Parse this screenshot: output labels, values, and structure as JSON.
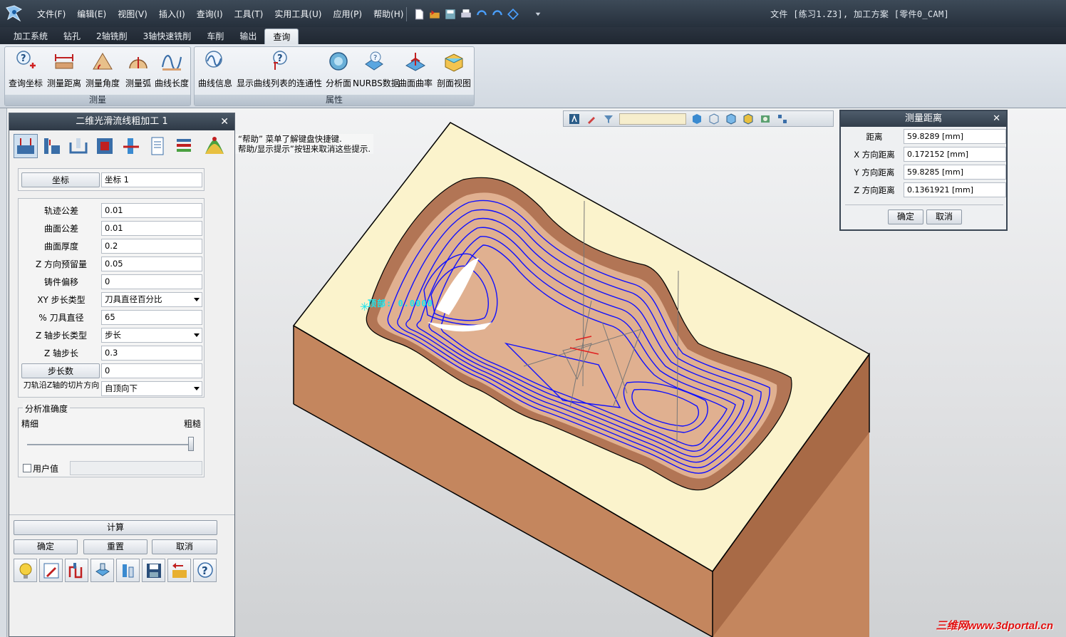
{
  "titlebar": {
    "menus": [
      "文件(F)",
      "编辑(E)",
      "视图(V)",
      "插入(I)",
      "查询(I)",
      "工具(T)",
      "实用工具(U)",
      "应用(P)",
      "帮助(H)"
    ],
    "title": "文件 [练习1.Z3], 加工方案 [零件0_CAM]"
  },
  "ribbon_tabs": [
    "加工系统",
    "钻孔",
    "2轴铣削",
    "3轴快速铣削",
    "车削",
    "输出",
    "查询"
  ],
  "active_tab": "查询",
  "ribbon": {
    "group_measure": {
      "label": "测量",
      "buttons": [
        "查询坐标",
        "测量距离",
        "测量角度",
        "测量弧",
        "曲线长度"
      ]
    },
    "group_props": {
      "label": "属性",
      "buttons": [
        "曲线信息",
        "显示曲线列表的连通性",
        "分析面",
        "NURBS数据",
        "曲面曲率",
        "剖面视图"
      ]
    }
  },
  "viewport": {
    "hint_line1": "“帮助” 菜单了解键盘快捷键.",
    "hint_line2": "帮助/显示提示”按钮来取消这些提示.",
    "annotation": "顶部: 0.0000",
    "watermark": "三维网www.3dportal.cn",
    "colors": {
      "toolpath": "#1010ff",
      "stock_top": "#fbf3cc",
      "stock_side": "#c98a62",
      "cavity": "#b27555"
    }
  },
  "panel": {
    "title": "二维光滑流线粗加工 1",
    "coord_button": "坐标",
    "coord_value": "坐标 1",
    "params": [
      {
        "label": "轨迹公差",
        "value": "0.01",
        "kind": "text"
      },
      {
        "label": "曲面公差",
        "value": "0.01",
        "kind": "text"
      },
      {
        "label": "曲面厚度",
        "value": "0.2",
        "kind": "text"
      },
      {
        "label": "Z 方向预留量",
        "value": "0.05",
        "kind": "text"
      },
      {
        "label": "铸件偏移",
        "value": "0",
        "kind": "text"
      },
      {
        "label": "XY 步长类型",
        "value": "刀具直径百分比",
        "kind": "select"
      },
      {
        "label": "% 刀具直径",
        "value": "65",
        "kind": "text"
      },
      {
        "label": "Z 轴步长类型",
        "value": "步长",
        "kind": "select"
      },
      {
        "label": "Z 轴步长",
        "value": "0.3",
        "kind": "text"
      },
      {
        "label": "步长数",
        "value": "0",
        "kind": "button"
      },
      {
        "label": "刀轨沿Z轴的切片方向",
        "value": "自顶向下",
        "kind": "select"
      }
    ],
    "accuracy": {
      "legend": "分析准确度",
      "fine": "精细",
      "coarse": "粗糙",
      "slider_value": 1.0,
      "user_value_label": "用户值"
    },
    "buttons": {
      "compute": "计算",
      "ok": "确定",
      "reset": "重置",
      "cancel": "取消"
    }
  },
  "measure_dialog": {
    "title": "测量距离",
    "rows": [
      {
        "label": "距离",
        "value": "59.8289 [mm]"
      },
      {
        "label": "X 方向距离",
        "value": "0.172152 [mm]"
      },
      {
        "label": "Y 方向距离",
        "value": "59.8285 [mm]"
      },
      {
        "label": "Z 方向距离",
        "value": "0.1361921 [mm]"
      }
    ],
    "ok": "确定",
    "cancel": "取消"
  }
}
